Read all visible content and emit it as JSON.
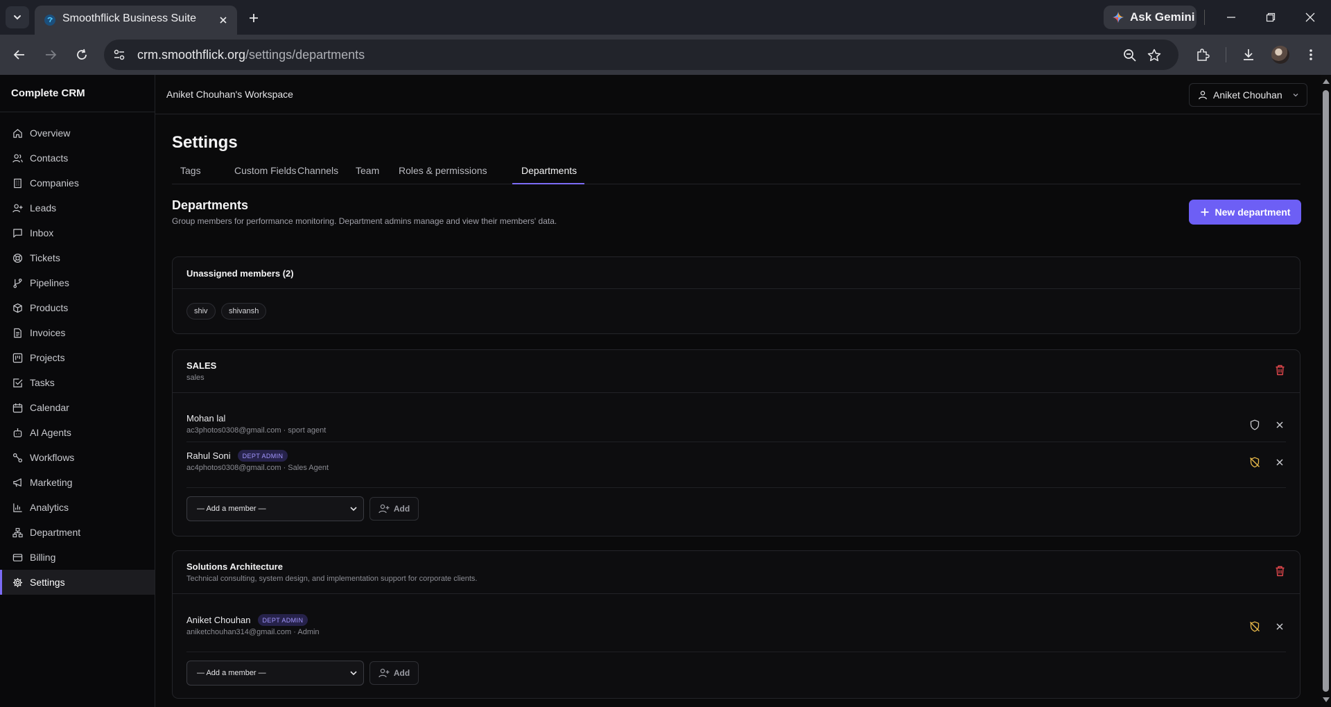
{
  "browser": {
    "tab_title": "Smoothflick Business Suite",
    "url_host": "crm.smoothflick.org",
    "url_path": "/settings/departments",
    "gemini_label": "Ask Gemini"
  },
  "sidebar": {
    "brand": "Complete CRM",
    "items": [
      {
        "label": "Overview",
        "icon": "home-icon"
      },
      {
        "label": "Contacts",
        "icon": "users-icon"
      },
      {
        "label": "Companies",
        "icon": "building-icon"
      },
      {
        "label": "Leads",
        "icon": "user-plus-icon"
      },
      {
        "label": "Inbox",
        "icon": "message-square-icon"
      },
      {
        "label": "Tickets",
        "icon": "lifebuoy-icon"
      },
      {
        "label": "Pipelines",
        "icon": "git-branch-icon"
      },
      {
        "label": "Products",
        "icon": "package-icon"
      },
      {
        "label": "Invoices",
        "icon": "file-text-icon"
      },
      {
        "label": "Projects",
        "icon": "kanban-icon"
      },
      {
        "label": "Tasks",
        "icon": "check-square-icon"
      },
      {
        "label": "Calendar",
        "icon": "calendar-icon"
      },
      {
        "label": "AI Agents",
        "icon": "bot-icon"
      },
      {
        "label": "Workflows",
        "icon": "workflow-icon"
      },
      {
        "label": "Marketing",
        "icon": "megaphone-icon"
      },
      {
        "label": "Analytics",
        "icon": "bar-chart-icon"
      },
      {
        "label": "Department",
        "icon": "network-icon"
      },
      {
        "label": "Billing",
        "icon": "credit-card-icon"
      },
      {
        "label": "Settings",
        "icon": "gear-icon",
        "active": true
      }
    ]
  },
  "header": {
    "workspace": "Aniket Chouhan's Workspace",
    "user_name": "Aniket Chouhan"
  },
  "settings": {
    "title": "Settings",
    "tabs": [
      "Tags",
      "Custom Fields",
      "Channels",
      "Team",
      "Roles & permissions",
      "Departments"
    ],
    "active_tab": "Departments"
  },
  "departments": {
    "title": "Departments",
    "description": "Group members for performance monitoring. Department admins manage and view their members' data.",
    "new_button": "New department",
    "unassigned": {
      "title": "Unassigned members (2)",
      "members": [
        "shiv",
        "shivansh"
      ]
    },
    "list": [
      {
        "name": "SALES",
        "description": "sales",
        "members": [
          {
            "name": "Mohan lal",
            "meta": "ac3photos0308@gmail.com · sport agent",
            "admin": false
          },
          {
            "name": "Rahul Soni",
            "badge": "DEPT ADMIN",
            "meta": "ac4photos0308@gmail.com · Sales Agent",
            "admin": true
          }
        ],
        "add_placeholder": "— Add a member —",
        "add_label": "Add"
      },
      {
        "name": "Solutions Architecture",
        "description": "Technical consulting, system design, and implementation support for corporate clients.",
        "members": [
          {
            "name": "Aniket Chouhan",
            "badge": "DEPT ADMIN",
            "meta": "aniketchouhan314@gmail.com · Admin",
            "admin": true
          }
        ],
        "add_placeholder": "— Add a member —",
        "add_label": "Add"
      }
    ]
  },
  "colors": {
    "accent": "#6d5ff5",
    "danger": "#e5484d",
    "admin_icon": "#e9b949"
  }
}
